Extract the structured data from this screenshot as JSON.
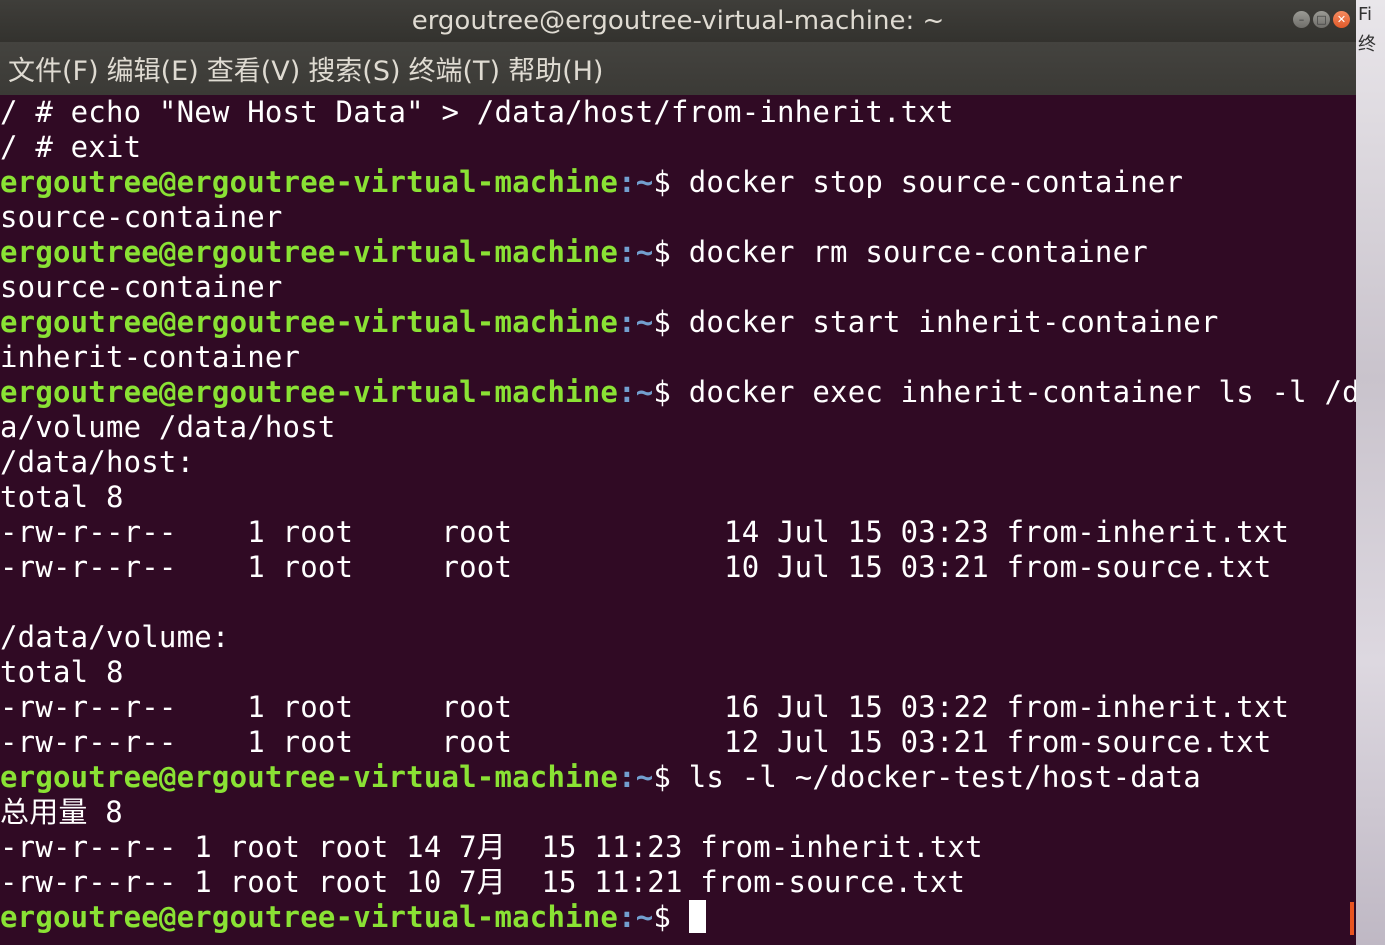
{
  "window": {
    "title": "ergoutree@ergoutree-virtual-machine: ~",
    "buttons": {
      "minimize": "–",
      "maximize": "□",
      "close": "✕"
    }
  },
  "menu": [
    "文件(F)",
    "编辑(E)",
    "查看(V)",
    "搜索(S)",
    "终端(T)",
    "帮助(H)"
  ],
  "prompt": {
    "user_host": "ergoutree@ergoutree-virtual-machine",
    "path": ":~",
    "symbol": "$"
  },
  "lines": [
    {
      "type": "out",
      "text": "/ # echo \"New Host Data\" > /data/host/from-inherit.txt"
    },
    {
      "type": "out",
      "text": "/ # exit"
    },
    {
      "type": "cmd",
      "text": " docker stop source-container"
    },
    {
      "type": "out",
      "text": "source-container"
    },
    {
      "type": "cmd",
      "text": " docker rm source-container"
    },
    {
      "type": "out",
      "text": "source-container"
    },
    {
      "type": "cmd",
      "text": " docker start inherit-container"
    },
    {
      "type": "out",
      "text": "inherit-container"
    },
    {
      "type": "cmd",
      "text": " docker exec inherit-container ls -l /dat"
    },
    {
      "type": "out",
      "text": "a/volume /data/host"
    },
    {
      "type": "out",
      "text": "/data/host:"
    },
    {
      "type": "out",
      "text": "total 8"
    },
    {
      "type": "out",
      "text": "-rw-r--r--    1 root     root            14 Jul 15 03:23 from-inherit.txt"
    },
    {
      "type": "out",
      "text": "-rw-r--r--    1 root     root            10 Jul 15 03:21 from-source.txt"
    },
    {
      "type": "out",
      "text": ""
    },
    {
      "type": "out",
      "text": "/data/volume:"
    },
    {
      "type": "out",
      "text": "total 8"
    },
    {
      "type": "out",
      "text": "-rw-r--r--    1 root     root            16 Jul 15 03:22 from-inherit.txt"
    },
    {
      "type": "out",
      "text": "-rw-r--r--    1 root     root            12 Jul 15 03:21 from-source.txt"
    },
    {
      "type": "cmd",
      "text": " ls -l ~/docker-test/host-data"
    },
    {
      "type": "out",
      "text": "总用量 8"
    },
    {
      "type": "out",
      "text": "-rw-r--r-- 1 root root 14 7月  15 11:23 from-inherit.txt"
    },
    {
      "type": "out",
      "text": "-rw-r--r-- 1 root root 10 7月  15 11:21 from-source.txt"
    },
    {
      "type": "cmd",
      "text": " ",
      "cursor": true
    }
  ],
  "side_panel": {
    "line1": "Fi",
    "line2": "终"
  },
  "colors": {
    "background": "#300a24",
    "prompt_user": "#8ae234",
    "prompt_path": "#729fcf",
    "text": "#ffffff"
  }
}
